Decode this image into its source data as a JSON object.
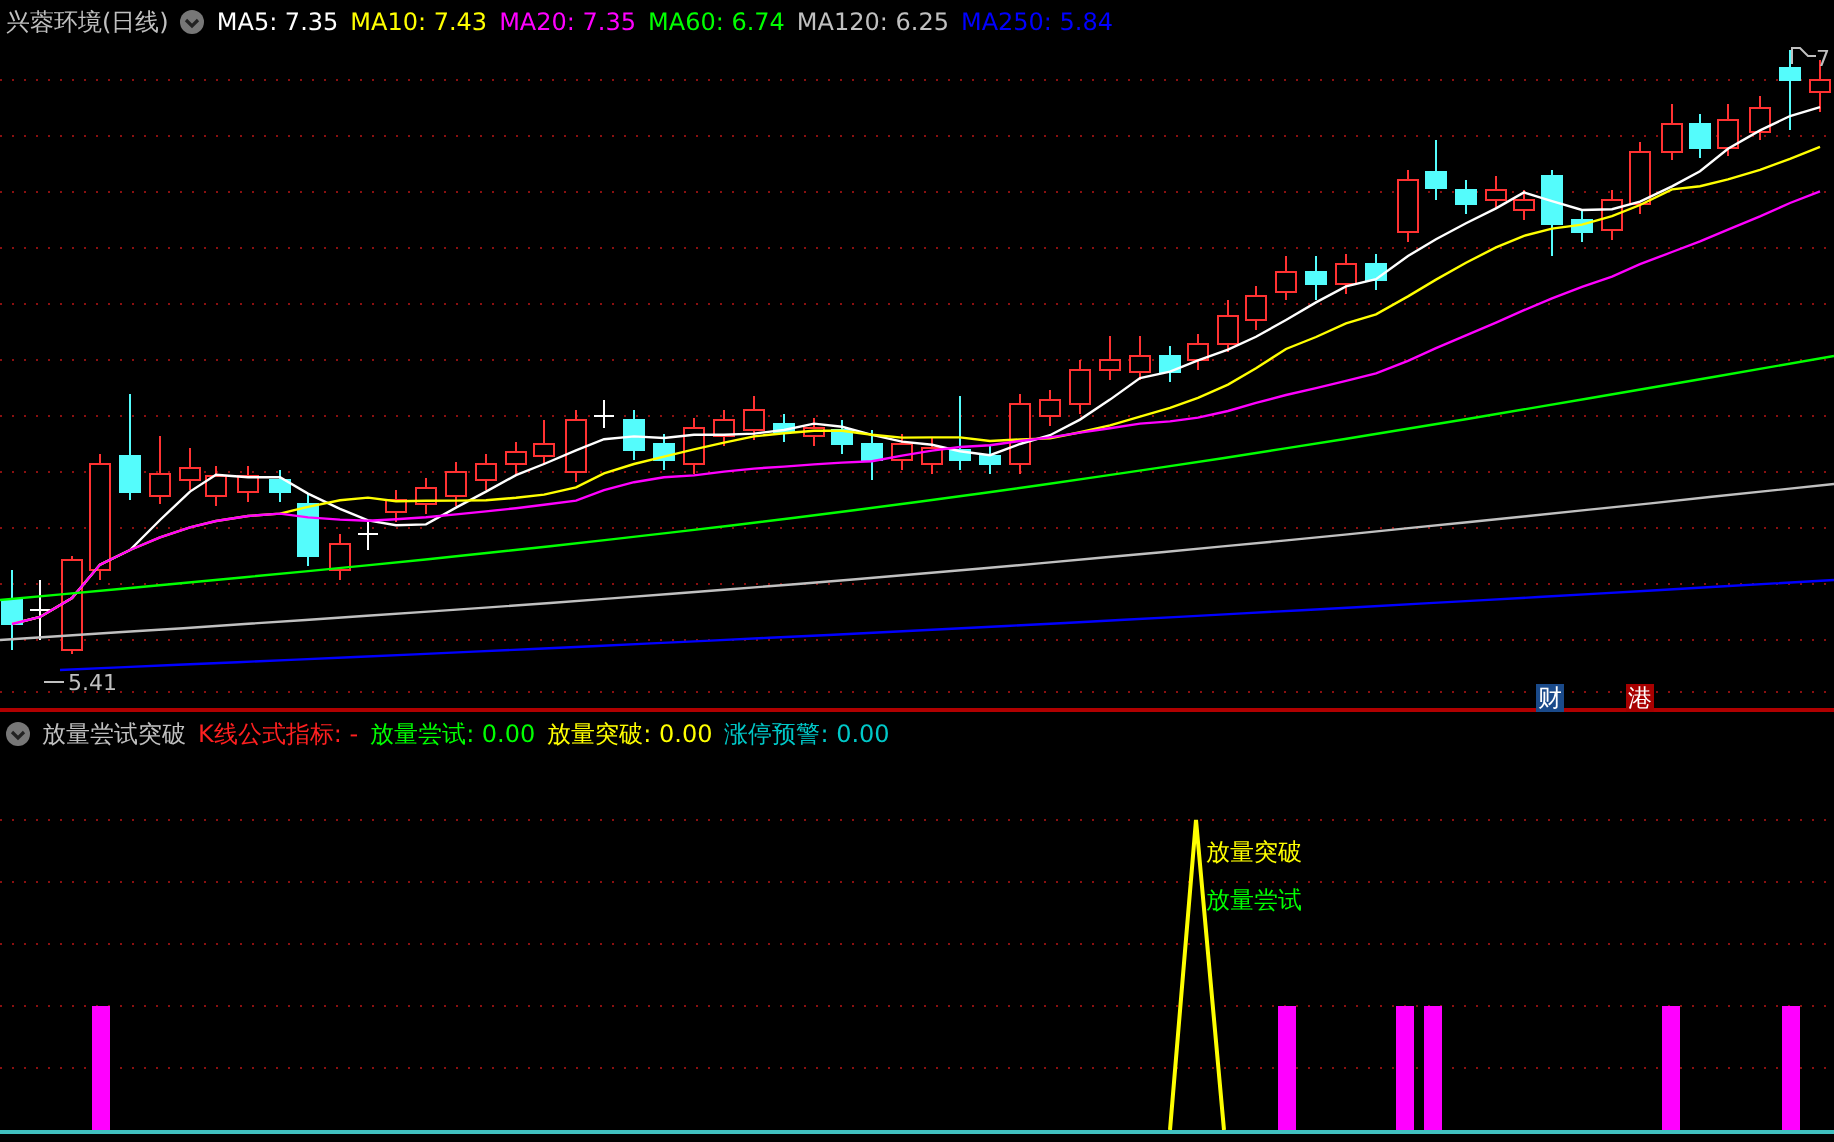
{
  "title": "兴蓉环境(日线)",
  "ma_legend": [
    {
      "label": "MA5: 7.35",
      "color": "#ffffff"
    },
    {
      "label": "MA10: 7.43",
      "color": "#ffff00"
    },
    {
      "label": "MA20: 7.35",
      "color": "#ff00ff"
    },
    {
      "label": "MA60: 6.74",
      "color": "#00ff00"
    },
    {
      "label": "MA120: 6.25",
      "color": "#c0c0c0"
    },
    {
      "label": "MA250: 5.84",
      "color": "#0000ff"
    }
  ],
  "price_labels": {
    "low": "5.41",
    "high": "7"
  },
  "badges": [
    {
      "label": "财",
      "color": "#1a4a8a"
    },
    {
      "label": "港",
      "color": "#a80000"
    }
  ],
  "indicator": {
    "name": "放量尝试突破",
    "legend": [
      {
        "label": "K线公式指标: -",
        "color": "#ff2020"
      },
      {
        "label": "放量尝试: 0.00",
        "color": "#00ff00"
      },
      {
        "label": "放量突破: 0.00",
        "color": "#ffff00"
      },
      {
        "label": "涨停预警: 0.00",
        "color": "#00c8c8"
      }
    ],
    "signals": [
      {
        "label": "放量突破",
        "color": "#ffff00"
      },
      {
        "label": "放量尝试",
        "color": "#00ff00"
      }
    ]
  }
}
